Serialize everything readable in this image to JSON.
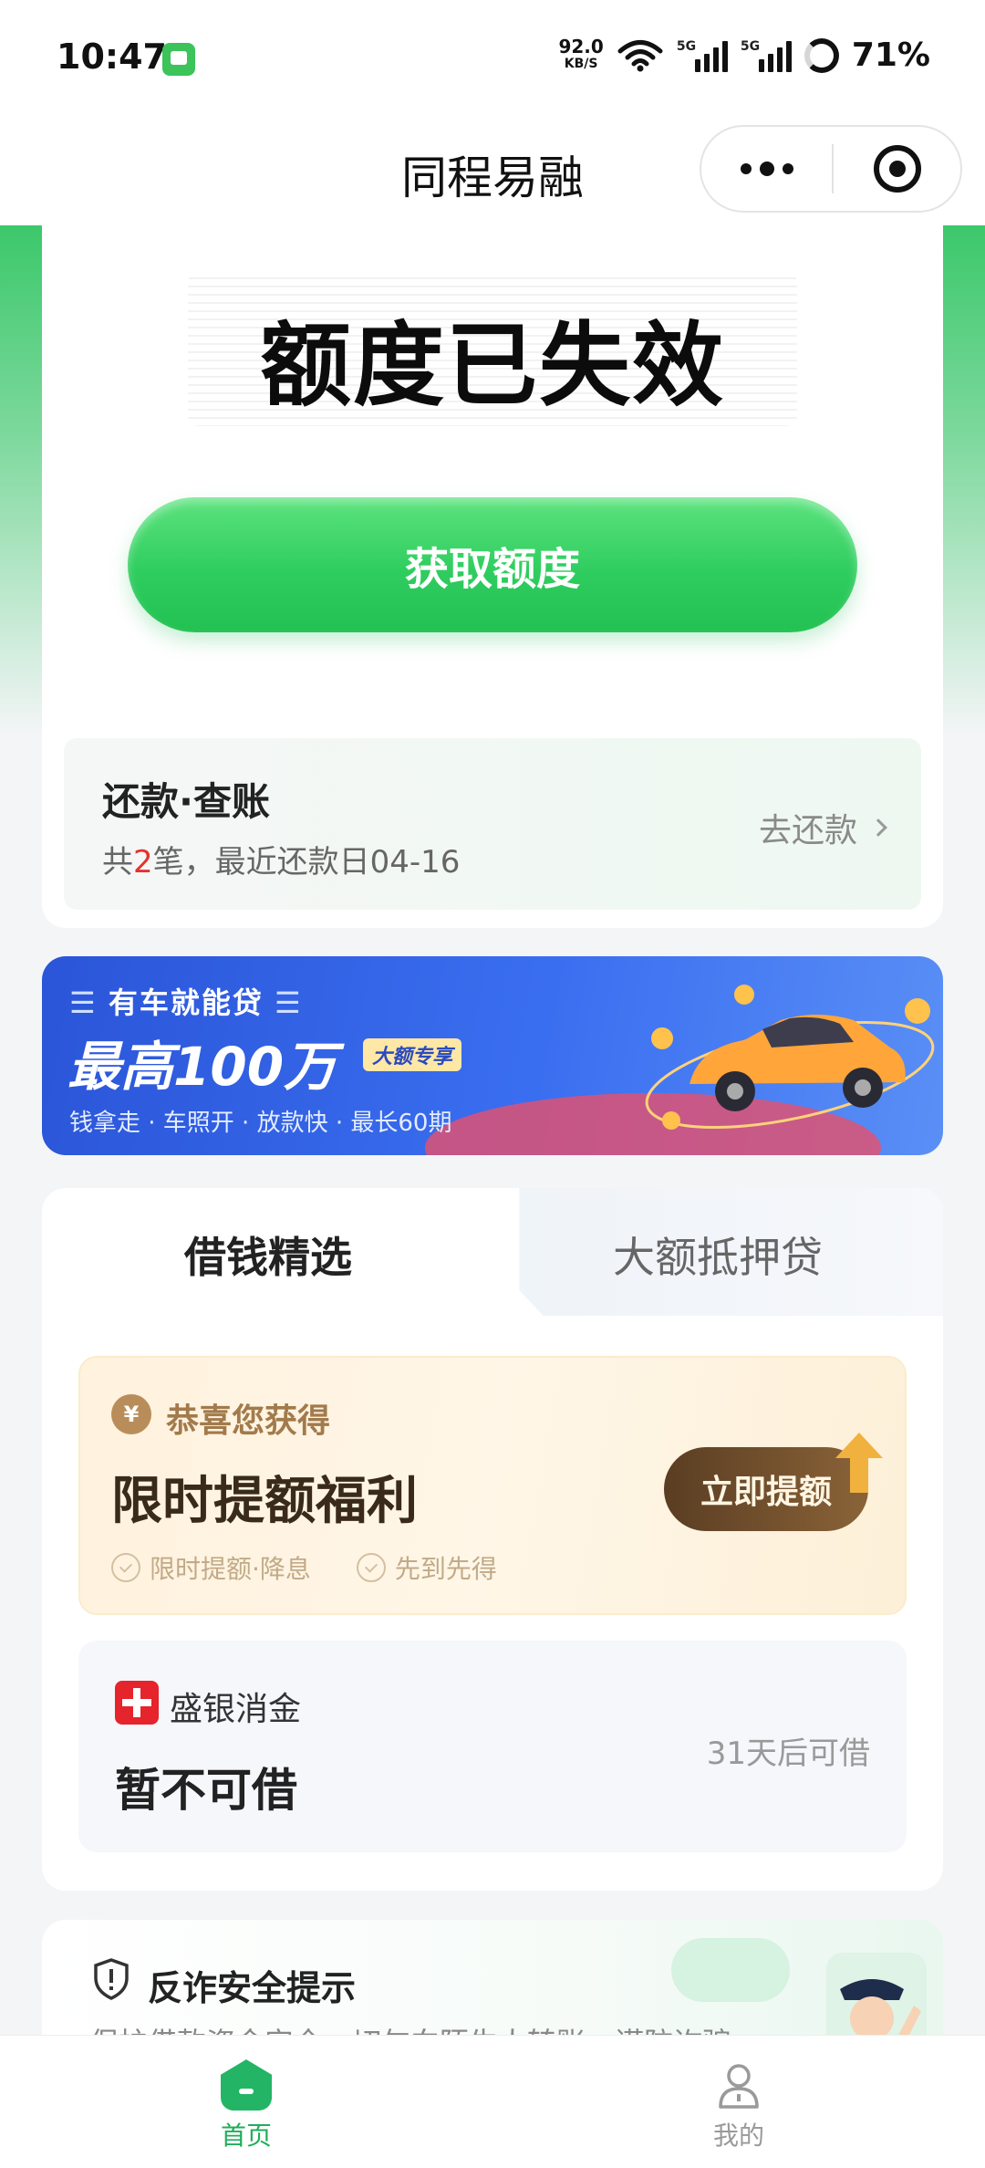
{
  "status_bar": {
    "time": "10:47",
    "net_speed": "92.0",
    "net_speed_unit": "KB/S",
    "signal_1_label": "5G",
    "signal_2_label": "5G",
    "battery": "71%"
  },
  "nav": {
    "title": "同程易融"
  },
  "quota": {
    "status": "额度已失效",
    "button_label": "获取额度"
  },
  "repay": {
    "title": "还款·查账",
    "sub_prefix": "共",
    "count": "2",
    "sub_suffix": "笔，最近还款日04-16",
    "link_label": "去还款"
  },
  "banner": {
    "tag": "有车就能贷",
    "headline": "最高100万",
    "badge": "大额专享",
    "features": "钱拿走 · 车照开 · 放款快 · 最长60期"
  },
  "products": {
    "tabs": [
      {
        "label": "借钱精选",
        "active": true
      },
      {
        "label": "大额抵押贷",
        "active": false
      }
    ],
    "promo": {
      "coin_symbol": "¥",
      "label": "恭喜您获得",
      "title": "限时提额福利",
      "checks": [
        "限时提额·降息",
        "先到先得"
      ],
      "button_label": "立即提额"
    },
    "lender": {
      "name": "盛银消金",
      "status": "暂不可借",
      "note": "31天后可借"
    }
  },
  "safety": {
    "title": "反诈安全提示",
    "text": "保护借款资金安全，切勿向陌生人转账，谨防诈骗"
  },
  "tab_bar": {
    "items": [
      {
        "label": "首页",
        "icon": "home-icon",
        "active": true
      },
      {
        "label": "我的",
        "icon": "user-icon",
        "active": false
      }
    ]
  },
  "colors": {
    "brand_green": "#2fcd5f",
    "accent_red": "#e5322d",
    "banner_blue": "#3a6ef0",
    "promo_brown": "#5a3d22"
  }
}
